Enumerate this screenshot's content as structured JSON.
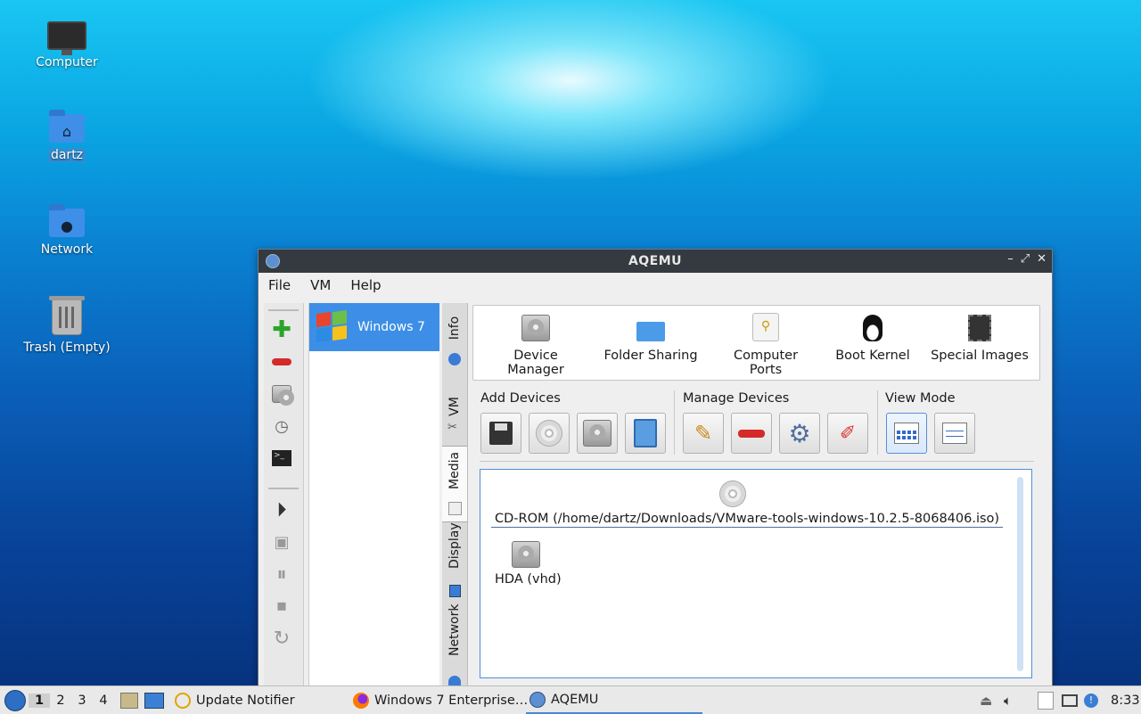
{
  "desktop": {
    "icons": [
      {
        "label": "Computer",
        "icon": "computer-icon"
      },
      {
        "label": "dartz",
        "icon": "home-folder-icon"
      },
      {
        "label": "Network",
        "icon": "network-folder-icon"
      },
      {
        "label": "Trash (Empty)",
        "icon": "trash-icon"
      }
    ]
  },
  "window": {
    "title": "AQEMU",
    "controls": {
      "minimize": "–",
      "maximize": "⤢",
      "close": "✕"
    },
    "menu": [
      "File",
      "VM",
      "Help"
    ],
    "vm_list": [
      {
        "name": "Windows 7",
        "selected": true
      }
    ],
    "side_tabs": [
      "Info",
      "VM",
      "Media",
      "Display",
      "Network"
    ],
    "active_tab": "Media",
    "top_items": [
      "Device Manager",
      "Folder Sharing",
      "Computer Ports",
      "Boot Kernel",
      "Special Images"
    ],
    "groups": {
      "add": "Add Devices",
      "manage": "Manage Devices",
      "view": "View Mode"
    },
    "media_items": [
      {
        "label": "CD-ROM (/home/dartz/Downloads/VMware-tools-windows-10.2.5-8068406.iso)",
        "type": "cdrom"
      },
      {
        "label": "HDA (vhd)",
        "type": "hdd"
      }
    ]
  },
  "taskbar": {
    "workspaces": [
      "1",
      "2",
      "3",
      "4"
    ],
    "active_workspace": "1",
    "tasks": [
      {
        "label": "Update Notifier",
        "icon": "update-notifier-icon"
      },
      {
        "label": "Windows 7 Enterprise…",
        "icon": "firefox-icon"
      },
      {
        "label": "AQEMU",
        "icon": "aqemu-icon"
      }
    ],
    "clock": "8:33"
  },
  "colors": {
    "accent": "#3d8ee6",
    "titlebar": "#343a40"
  }
}
